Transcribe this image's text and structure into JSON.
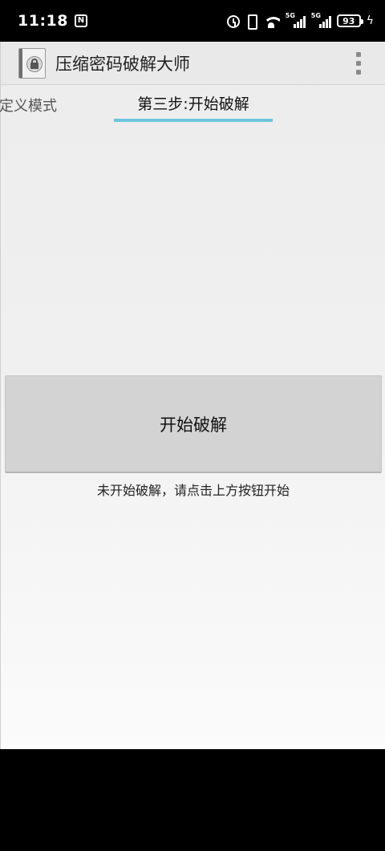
{
  "status_bar": {
    "time": "11:18",
    "nfc_glyph": "N",
    "signal_1_tag": "5G",
    "signal_2_tag": "5G",
    "battery": "93",
    "bolt": "ϟ",
    "icons": [
      "nfc-icon",
      "alarm-icon",
      "vibrate-icon",
      "wifi-icon",
      "signal-icon",
      "signal-icon",
      "battery-icon",
      "charging-bolt-icon"
    ]
  },
  "app_bar": {
    "title": "压缩密码破解大师",
    "icon": "lock-app-icon",
    "menu_icon": "overflow-menu-icon"
  },
  "tabs": {
    "previous": "定义模式",
    "current": "第三步:开始破解",
    "indicator_color": "#6fc4dd"
  },
  "main": {
    "start_button_label": "开始破解",
    "status_text": "未开始破解，请点击上方按钮开始"
  },
  "colors": {
    "button_bg": "#d3d3d3",
    "app_bar_bg": "#e9e9e9",
    "content_bg": "#f0f0f0"
  }
}
